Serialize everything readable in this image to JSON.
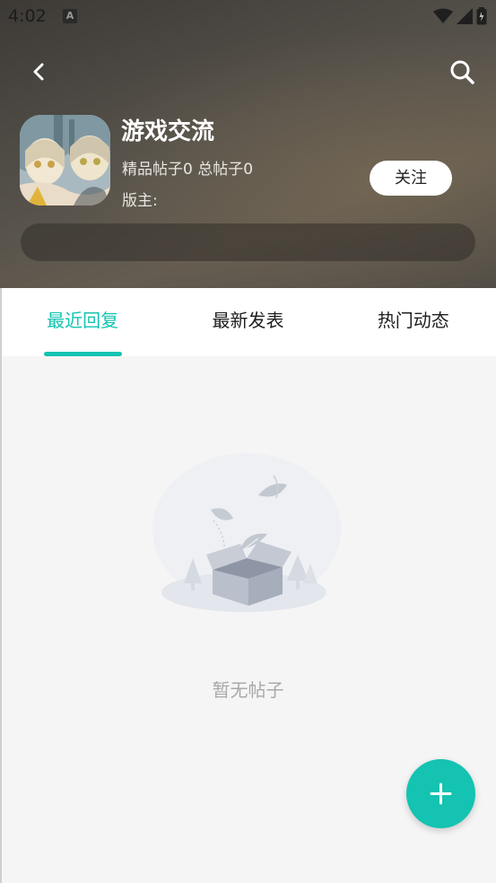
{
  "status_bar": {
    "time": "4:02",
    "icons": [
      "a-notification-icon",
      "wifi-icon",
      "signal-icon",
      "battery-icon"
    ]
  },
  "header": {
    "icons": [
      "back-icon",
      "search-icon"
    ]
  },
  "forum": {
    "title": "游戏交流",
    "stats": "精品帖子0 总帖子0",
    "moderator": "版主:",
    "follow_label": "关注"
  },
  "tabs": [
    {
      "label": "最近回复",
      "active": true
    },
    {
      "label": "最新发表",
      "active": false
    },
    {
      "label": "热门动态",
      "active": false
    }
  ],
  "empty_state": {
    "text": "暂无帖子",
    "icon": "empty-box-icon"
  },
  "fab": {
    "icon": "plus-icon"
  },
  "colors": {
    "accent": "#14c3b1",
    "header_bg": "#55514a",
    "background": "#f5f5f5"
  }
}
